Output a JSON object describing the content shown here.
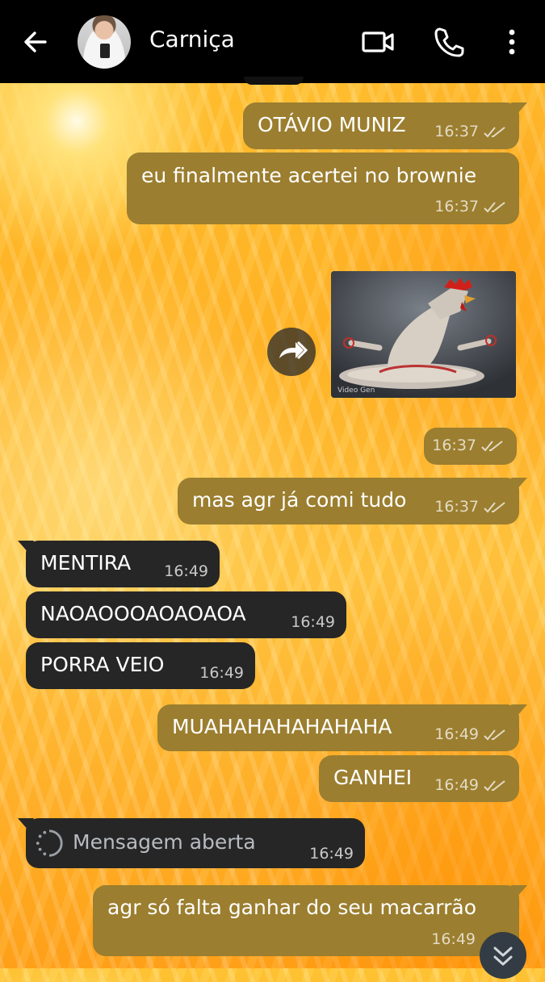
{
  "header": {
    "contact_name": "Carniça",
    "back_icon": "arrow-left-icon",
    "video_icon": "video-camera-icon",
    "call_icon": "phone-icon",
    "menu_icon": "more-vertical-icon"
  },
  "messages": [
    {
      "dir": "out",
      "text": "OTÁVIO MUNIZ",
      "time": "16:37",
      "status": "read"
    },
    {
      "dir": "out",
      "text": "eu finalmente acertei no brownie",
      "time": "16:37",
      "status": "read"
    },
    {
      "dir": "out",
      "type": "image",
      "caption": "",
      "time": "16:37",
      "status": "read",
      "watermark": "Video Gen"
    },
    {
      "dir": "out",
      "text": "mas agr já comi tudo",
      "time": "16:37",
      "status": "read"
    },
    {
      "dir": "in",
      "text": "MENTIRA",
      "time": "16:49"
    },
    {
      "dir": "in",
      "text": "NAOAOOOAOAOAOA",
      "time": "16:49"
    },
    {
      "dir": "in",
      "text": "PORRA VEIO",
      "time": "16:49"
    },
    {
      "dir": "out",
      "text": "MUAHAHAHAHAHAHA",
      "time": "16:49",
      "status": "read"
    },
    {
      "dir": "out",
      "text": "GANHEI",
      "time": "16:49",
      "status": "read"
    },
    {
      "dir": "in",
      "type": "view-once",
      "text": "Mensagem aberta",
      "time": "16:49"
    },
    {
      "dir": "out",
      "text": "agr só falta ganhar do seu macarrão",
      "time": "16:49",
      "status": "read"
    }
  ],
  "colors": {
    "outgoing": "#9b7e2f",
    "incoming": "#262626",
    "topbar": "#000000"
  }
}
